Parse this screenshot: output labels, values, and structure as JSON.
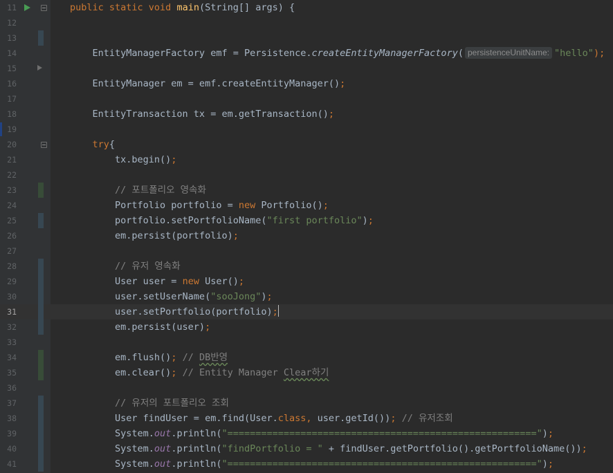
{
  "editor": {
    "lines": [
      {
        "n": "11",
        "html": "<span class=\"kw\">public static void </span><span class=\"fn\">main</span>(String[] args) {"
      },
      {
        "n": "12",
        "html": ""
      },
      {
        "n": "13",
        "html": ""
      },
      {
        "n": "14",
        "html": "    EntityManagerFactory emf = Persistence.<span class=\"it\">createEntityManagerFactory</span>(<span class=\"hint\">persistenceUnitName:</span><span class=\"str\">\"hello\"</span><span class=\"kw\">);</span>"
      },
      {
        "n": "15",
        "html": ""
      },
      {
        "n": "16",
        "html": "    EntityManager em = emf.createEntityManager()<span class=\"kw\">;</span>"
      },
      {
        "n": "17",
        "html": ""
      },
      {
        "n": "18",
        "html": "    EntityTransaction tx = em.getTransaction()<span class=\"kw\">;</span>"
      },
      {
        "n": "19",
        "html": ""
      },
      {
        "n": "20",
        "html": "    <span class=\"kw\">try</span>{"
      },
      {
        "n": "21",
        "html": "        tx.begin()<span class=\"kw\">;</span>"
      },
      {
        "n": "22",
        "html": ""
      },
      {
        "n": "23",
        "html": "        <span class=\"cm\">// 포트폴리오 영속화</span>"
      },
      {
        "n": "24",
        "html": "        Portfolio portfolio = <span class=\"kw\">new </span>Portfolio()<span class=\"kw\">;</span>"
      },
      {
        "n": "25",
        "html": "        portfolio.setPortfolioName(<span class=\"str\">\"first portfolio\"</span>)<span class=\"kw\">;</span>"
      },
      {
        "n": "26",
        "html": "        em.persist(portfolio)<span class=\"kw\">;</span>"
      },
      {
        "n": "27",
        "html": ""
      },
      {
        "n": "28",
        "html": "        <span class=\"cm\">// 유저 영속화</span>"
      },
      {
        "n": "29",
        "html": "        User user = <span class=\"kw\">new </span>User()<span class=\"kw\">;</span>"
      },
      {
        "n": "30",
        "html": "        user.setUserName(<span class=\"str\">\"sooJong\"</span>)<span class=\"kw\">;</span>"
      },
      {
        "n": "31",
        "html": "        user.setPortfolio(portfolio)<span class=\"kw\">;</span><span class=\"caret\"></span>"
      },
      {
        "n": "32",
        "html": "        em.persist(user)<span class=\"kw\">;</span>"
      },
      {
        "n": "33",
        "html": ""
      },
      {
        "n": "34",
        "html": "        em.flush()<span class=\"kw\">; </span><span class=\"cm\">// <span class=\"squig\">DB반영</span></span>"
      },
      {
        "n": "35",
        "html": "        em.clear()<span class=\"kw\">; </span><span class=\"cm\">// Entity Manager <span class=\"squig\">Clear하기</span></span>"
      },
      {
        "n": "36",
        "html": ""
      },
      {
        "n": "37",
        "html": "        <span class=\"cm\">// 유저의 포트폴리오 조회</span>"
      },
      {
        "n": "38",
        "html": "        User findUser = em.find(User.<span class=\"kw\">class, </span>user.getId())<span class=\"kw\">; </span><span class=\"cm\">// 유저조회</span>"
      },
      {
        "n": "39",
        "html": "        System.<span class=\"field\">out</span>.println(<span class=\"str\">\"=======================================================\"</span>)<span class=\"kw\">;</span>"
      },
      {
        "n": "40",
        "html": "        System.<span class=\"field\">out</span>.println(<span class=\"str\">\"findPortfolio = \" </span>+ findUser.getPortfolio().getPortfolioName())<span class=\"kw\">;</span>"
      },
      {
        "n": "41",
        "html": "        System.<span class=\"field\">out</span>.println(<span class=\"str\">\"=======================================================\"</span>)<span class=\"kw\">;</span>"
      }
    ],
    "current_line": "31",
    "vcs_markers": [
      {
        "line": "13",
        "kind": "mod"
      },
      {
        "line": "23",
        "kind": "add"
      },
      {
        "line": "25",
        "kind": "mod"
      },
      {
        "line": "28",
        "kind": "mod"
      },
      {
        "line": "29",
        "kind": "mod"
      },
      {
        "line": "30",
        "kind": "mod"
      },
      {
        "line": "31",
        "kind": "mod"
      },
      {
        "line": "32",
        "kind": "mod"
      },
      {
        "line": "34",
        "kind": "add"
      },
      {
        "line": "35",
        "kind": "add"
      },
      {
        "line": "37",
        "kind": "mod"
      },
      {
        "line": "38",
        "kind": "mod"
      },
      {
        "line": "39",
        "kind": "mod"
      },
      {
        "line": "40",
        "kind": "mod"
      },
      {
        "line": "41",
        "kind": "mod"
      }
    ],
    "icons": {
      "run_line": "11",
      "fold_lines": [
        "11",
        "20"
      ],
      "breakpoint_line": "15"
    }
  }
}
